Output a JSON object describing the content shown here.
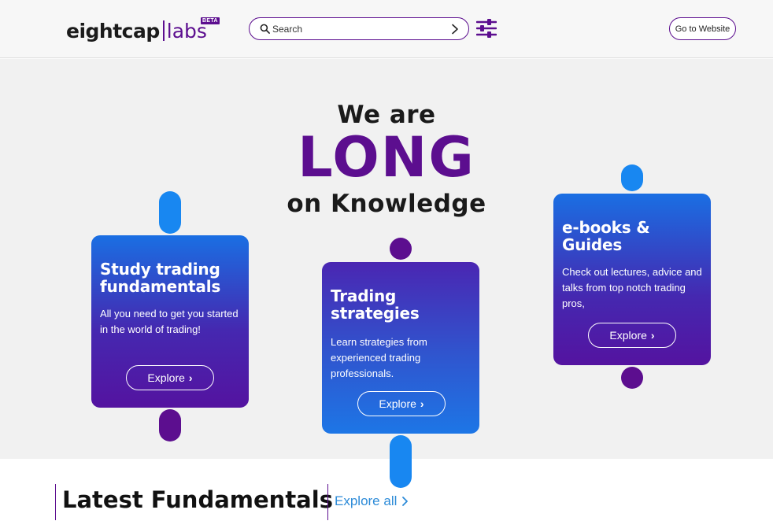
{
  "header": {
    "logo_main": "eightcap",
    "logo_labs": "labs",
    "logo_badge": "BETA",
    "search_placeholder": "Search",
    "goto_label": "Go to Website"
  },
  "hero": {
    "line1": "We are",
    "line2": "LONG",
    "line3": "on Knowledge"
  },
  "cards": [
    {
      "title": "Study trading fundamentals",
      "description": "All you need to get you started in the world of trading!",
      "button": "Explore"
    },
    {
      "title": "Trading strategies",
      "description": "Learn strategies from experienced trading professionals.",
      "button": "Explore"
    },
    {
      "title": "e-books & Guides",
      "description": "Check out lectures, advice and talks from top notch trading pros,",
      "button": "Explore"
    }
  ],
  "latest": {
    "title": "Latest Fundamentals",
    "link": "Explore all"
  },
  "colors": {
    "brand_purple": "#5c0e8f",
    "brand_blue": "#1887f1",
    "link_blue": "#2d8bd8"
  }
}
